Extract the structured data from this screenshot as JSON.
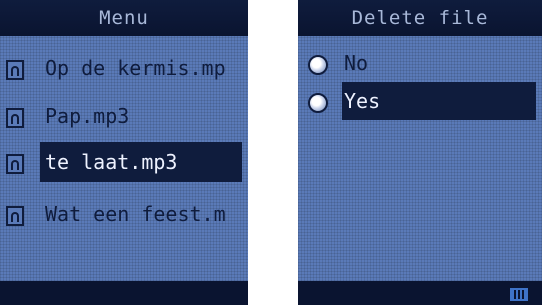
{
  "left_screen": {
    "title": "Menu",
    "items": [
      {
        "label": "Op de kermis.mp",
        "selected": false
      },
      {
        "label": "Pap.mp3",
        "selected": false
      },
      {
        "label": "te laat.mp3",
        "selected": true
      },
      {
        "label": "Wat een feest.m",
        "selected": false
      }
    ]
  },
  "right_screen": {
    "title": "Delete file",
    "options": [
      {
        "label": "No",
        "selected": false
      },
      {
        "label": "Yes",
        "selected": true
      }
    ],
    "status_icon": "battery-icon"
  },
  "colors": {
    "screen_bg": "#5a7ab8",
    "bar_bg": "#0a1430",
    "highlight": "#0f1c3d",
    "title_text": "#a8b8d8",
    "selected_text": "#eef2ff"
  }
}
